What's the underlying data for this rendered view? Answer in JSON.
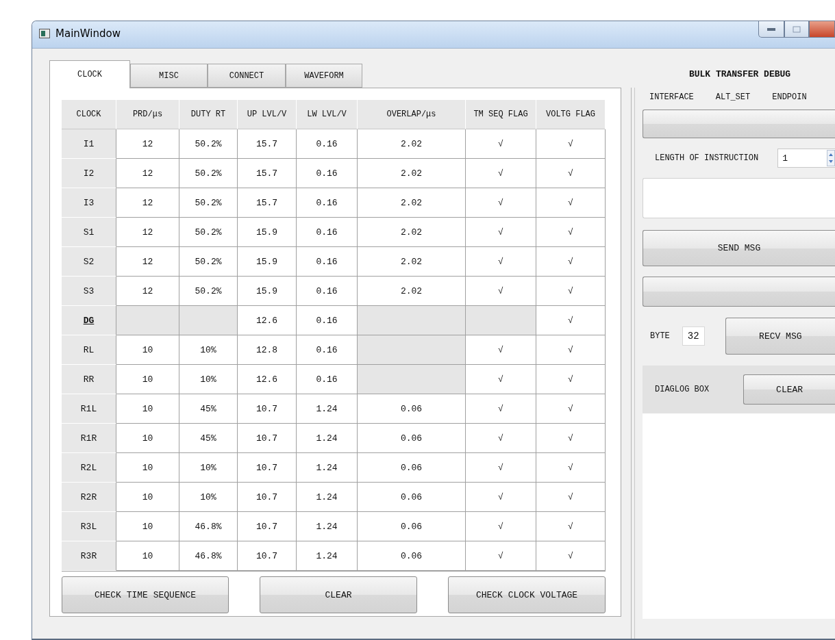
{
  "window": {
    "title": "MainWindow"
  },
  "tabs": [
    {
      "label": "CLOCK",
      "selected": true
    },
    {
      "label": "MISC",
      "selected": false
    },
    {
      "label": "CONNECT",
      "selected": false
    },
    {
      "label": "WAVEFORM",
      "selected": false
    }
  ],
  "clock_table": {
    "columns": [
      "CLOCK",
      "PRD/μs",
      "DUTY RT",
      "UP LVL/V",
      "LW LVL/V",
      "OVERLAP/μs",
      "TM SEQ FLAG",
      "VOLTG FLAG"
    ],
    "rows": [
      {
        "cells": [
          {
            "kind": "header",
            "text": "I1",
            "current": false
          },
          {
            "text": "12"
          },
          {
            "text": "50.2%"
          },
          {
            "text": "15.7"
          },
          {
            "text": "0.16"
          },
          {
            "text": "2.02"
          },
          {
            "text": "√"
          },
          {
            "text": "√"
          }
        ]
      },
      {
        "cells": [
          {
            "kind": "header",
            "text": "I2",
            "current": false
          },
          {
            "text": "12"
          },
          {
            "text": "50.2%"
          },
          {
            "text": "15.7"
          },
          {
            "text": "0.16"
          },
          {
            "text": "2.02"
          },
          {
            "text": "√"
          },
          {
            "text": "√"
          }
        ]
      },
      {
        "cells": [
          {
            "kind": "header",
            "text": "I3",
            "current": false
          },
          {
            "text": "12"
          },
          {
            "text": "50.2%"
          },
          {
            "text": "15.7"
          },
          {
            "text": "0.16"
          },
          {
            "text": "2.02"
          },
          {
            "text": "√"
          },
          {
            "text": "√"
          }
        ]
      },
      {
        "cells": [
          {
            "kind": "header",
            "text": "S1",
            "current": false
          },
          {
            "text": "12"
          },
          {
            "text": "50.2%"
          },
          {
            "text": "15.9"
          },
          {
            "text": "0.16"
          },
          {
            "text": "2.02"
          },
          {
            "text": "√"
          },
          {
            "text": "√"
          }
        ]
      },
      {
        "cells": [
          {
            "kind": "header",
            "text": "S2",
            "current": false
          },
          {
            "text": "12"
          },
          {
            "text": "50.2%"
          },
          {
            "text": "15.9"
          },
          {
            "text": "0.16"
          },
          {
            "text": "2.02"
          },
          {
            "text": "√"
          },
          {
            "text": "√"
          }
        ]
      },
      {
        "cells": [
          {
            "kind": "header",
            "text": "S3",
            "current": false
          },
          {
            "text": "12"
          },
          {
            "text": "50.2%"
          },
          {
            "text": "15.9"
          },
          {
            "text": "0.16"
          },
          {
            "text": "2.02"
          },
          {
            "text": "√"
          },
          {
            "text": "√"
          }
        ]
      },
      {
        "cells": [
          {
            "kind": "header",
            "text": "DG",
            "current": true
          },
          {
            "disabled": true
          },
          {
            "disabled": true
          },
          {
            "text": "12.6"
          },
          {
            "text": "0.16"
          },
          {
            "disabled": true
          },
          {
            "disabled": true
          },
          {
            "text": "√"
          }
        ]
      },
      {
        "cells": [
          {
            "kind": "header",
            "text": "RL",
            "current": false
          },
          {
            "text": "10"
          },
          {
            "text": "10%"
          },
          {
            "text": "12.8"
          },
          {
            "text": "0.16"
          },
          {
            "disabled": true
          },
          {
            "text": "√"
          },
          {
            "text": "√"
          }
        ]
      },
      {
        "cells": [
          {
            "kind": "header",
            "text": "RR",
            "current": false
          },
          {
            "text": "10"
          },
          {
            "text": "10%"
          },
          {
            "text": "12.6"
          },
          {
            "text": "0.16"
          },
          {
            "disabled": true
          },
          {
            "text": "√"
          },
          {
            "text": "√"
          }
        ]
      },
      {
        "cells": [
          {
            "kind": "header",
            "text": "R1L",
            "current": false
          },
          {
            "text": "10"
          },
          {
            "text": "45%"
          },
          {
            "text": "10.7"
          },
          {
            "text": "1.24"
          },
          {
            "text": "0.06"
          },
          {
            "text": "√"
          },
          {
            "text": "√"
          }
        ]
      },
      {
        "cells": [
          {
            "kind": "header",
            "text": "R1R",
            "current": false
          },
          {
            "text": "10"
          },
          {
            "text": "45%"
          },
          {
            "text": "10.7"
          },
          {
            "text": "1.24"
          },
          {
            "text": "0.06"
          },
          {
            "text": "√"
          },
          {
            "text": "√"
          }
        ]
      },
      {
        "cells": [
          {
            "kind": "header",
            "text": "R2L",
            "current": false
          },
          {
            "text": "10"
          },
          {
            "text": "10%"
          },
          {
            "text": "10.7"
          },
          {
            "text": "1.24"
          },
          {
            "text": "0.06"
          },
          {
            "text": "√"
          },
          {
            "text": "√"
          }
        ]
      },
      {
        "cells": [
          {
            "kind": "header",
            "text": "R2R",
            "current": false
          },
          {
            "text": "10"
          },
          {
            "text": "10%"
          },
          {
            "text": "10.7"
          },
          {
            "text": "1.24"
          },
          {
            "text": "0.06"
          },
          {
            "text": "√"
          },
          {
            "text": "√"
          }
        ]
      },
      {
        "cells": [
          {
            "kind": "header",
            "text": "R3L",
            "current": false
          },
          {
            "text": "10"
          },
          {
            "text": "46.8%"
          },
          {
            "text": "10.7"
          },
          {
            "text": "1.24"
          },
          {
            "text": "0.06"
          },
          {
            "text": "√"
          },
          {
            "text": "√"
          }
        ]
      },
      {
        "cells": [
          {
            "kind": "header",
            "text": "R3R",
            "current": false
          },
          {
            "text": "10"
          },
          {
            "text": "46.8%"
          },
          {
            "text": "10.7"
          },
          {
            "text": "1.24"
          },
          {
            "text": "0.06"
          },
          {
            "text": "√"
          },
          {
            "text": "√"
          }
        ]
      }
    ]
  },
  "actions": [
    "CHECK TIME SEQUENCE",
    "CLEAR",
    "CHECK CLOCK VOLTAGE"
  ],
  "bulk_panel": {
    "title": "BULK TRANSFER DEBUG",
    "columns": [
      "INTERFACE",
      "ALT_SET",
      "ENDPOIN"
    ],
    "instruction_length": {
      "label": "LENGTH OF INSTRUCTION",
      "value": "1"
    },
    "send_button": "SEND MSG",
    "byte": {
      "label": "BYTE",
      "value": "32"
    },
    "recv_button": "RECV MSG",
    "dialog": {
      "label": "DIAGLOG BOX",
      "button": "CLEAR"
    }
  }
}
